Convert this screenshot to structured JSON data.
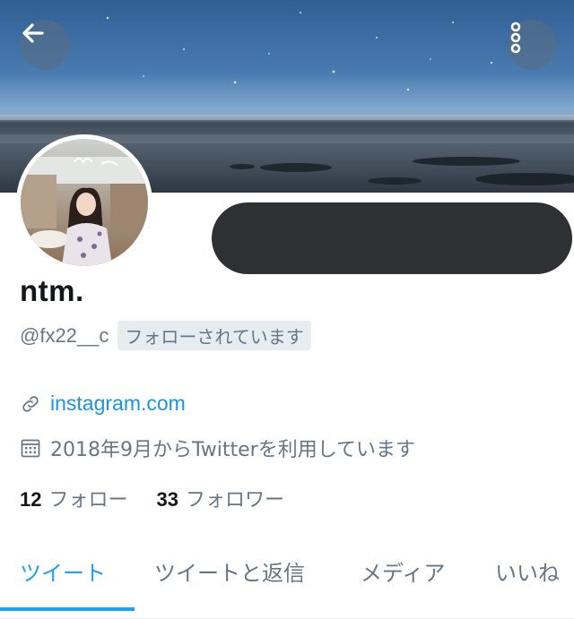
{
  "header": {
    "back_icon": "arrow-left-icon",
    "more_icon": "vertical-dots-icon"
  },
  "profile": {
    "display_name": "ntm.",
    "handle": "@fx22__c",
    "follows_you_badge": "フォローされています",
    "link_icon": "link-icon",
    "link": "instagram.com",
    "calendar_icon": "calendar-icon",
    "joined": "2018年9月からTwitterを利用しています",
    "following_count": "12",
    "following_label": "フォロー",
    "followers_count": "33",
    "followers_label": "フォロワー"
  },
  "tabs": [
    {
      "label": "ツイート",
      "active": true
    },
    {
      "label": "ツイートと返信",
      "active": false
    },
    {
      "label": "メディア",
      "active": false
    },
    {
      "label": "いいね",
      "active": false
    }
  ],
  "colors": {
    "accent": "#1da1f2",
    "link": "#1b95e0",
    "muted": "#657786",
    "text": "#14171a",
    "redaction": "#2d3134"
  }
}
